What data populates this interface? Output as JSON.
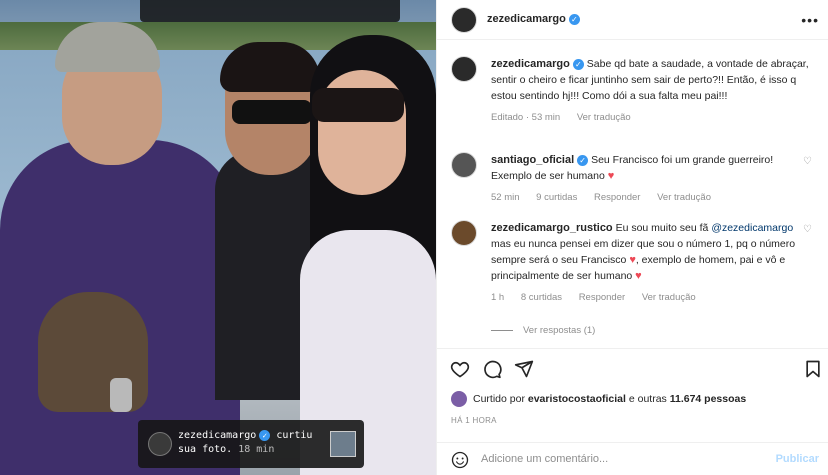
{
  "photo": {
    "liked_notice": {
      "username": "zezedicamargo",
      "text": "curtiu sua foto.",
      "time": "18 min"
    }
  },
  "post": {
    "author": "zezedicamargo",
    "more_icon": "more-horizontal-icon",
    "caption": {
      "username": "zezedicamargo",
      "text": "Sabe qd bate a saudade, a vontade de abraçar, sentir o cheiro e ficar juntinho sem sair de perto?!! Então, é isso q estou sentindo hj!!! Como dói a sua falta meu pai!!!",
      "edited": "Editado · 53 min",
      "translate": "Ver tradução"
    },
    "comments": [
      {
        "username": "santiago_oficial",
        "text": "Seu Francisco foi um grande guerreiro! Exemplo de ser humano",
        "time": "52 min",
        "likes": "9 curtidas",
        "reply": "Responder",
        "translate": "Ver tradução"
      },
      {
        "username": "zezedicamargo_rustico",
        "text_a": "Eu sou muito seu fã",
        "mention": "@zezedicamargo",
        "text_b": "mas eu nunca pensei em dizer que sou o número 1, pq o número sempre será o seu Francisco",
        "text_c": ", exemplo de homem, pai e vô e principalmente de ser humano",
        "time": "1 h",
        "likes": "8 curtidas",
        "reply": "Responder",
        "translate": "Ver tradução"
      }
    ],
    "view_replies": "Ver respostas (1)",
    "liked_by_prefix": "Curtido por",
    "liked_by_user": "evaristocostaoficial",
    "liked_by_middle": "e outras",
    "liked_by_count": "11.674 pessoas",
    "time_ago": "HÁ 1 HORA",
    "comment_placeholder": "Adicione um comentário...",
    "publish_label": "Publicar"
  },
  "colors": {
    "verified": "#3897f0",
    "heart": "#ed4956",
    "publish_disabled": "#b3dbff",
    "mention": "#00376b"
  }
}
